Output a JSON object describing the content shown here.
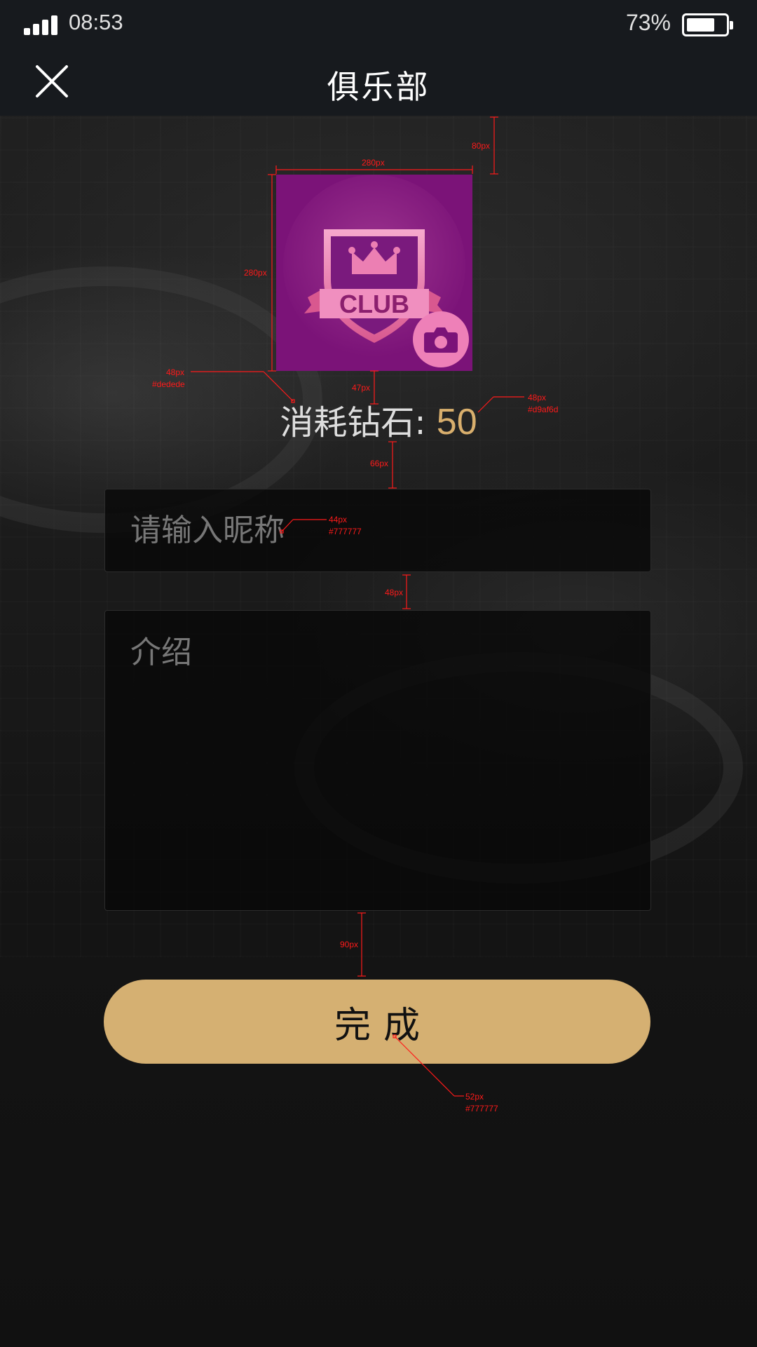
{
  "status_bar": {
    "time": "08:53",
    "battery_percent": "73%",
    "battery_level": 0.73,
    "signal_bars": 4
  },
  "nav": {
    "title": "俱乐部",
    "close_icon": "close-icon"
  },
  "avatar": {
    "badge_text": "CLUB",
    "camera_icon": "camera-icon",
    "colors": {
      "background": "#7b1378",
      "accent": "#ee80b8"
    }
  },
  "cost": {
    "label": "消耗钻石:",
    "value": "50",
    "colors": {
      "label": "#dedede",
      "value": "#d9af6d"
    }
  },
  "form": {
    "nickname_placeholder": "请输入昵称",
    "nickname_value": "",
    "intro_placeholder": "介绍",
    "intro_value": "",
    "placeholder_color": "#777777"
  },
  "done_button": {
    "label": "完成",
    "color": "#d5b072"
  },
  "annotations": [
    {
      "text": "80px"
    },
    {
      "text": "280px"
    },
    {
      "text": "280px"
    },
    {
      "text": "48px",
      "sub": "#dedede"
    },
    {
      "text": "47px"
    },
    {
      "text": "48px",
      "sub": "#d9af6d"
    },
    {
      "text": "66px"
    },
    {
      "text": "44px",
      "sub": "#777777"
    },
    {
      "text": "48px"
    },
    {
      "text": "90px"
    },
    {
      "text": "52px",
      "sub": "#777777"
    }
  ]
}
